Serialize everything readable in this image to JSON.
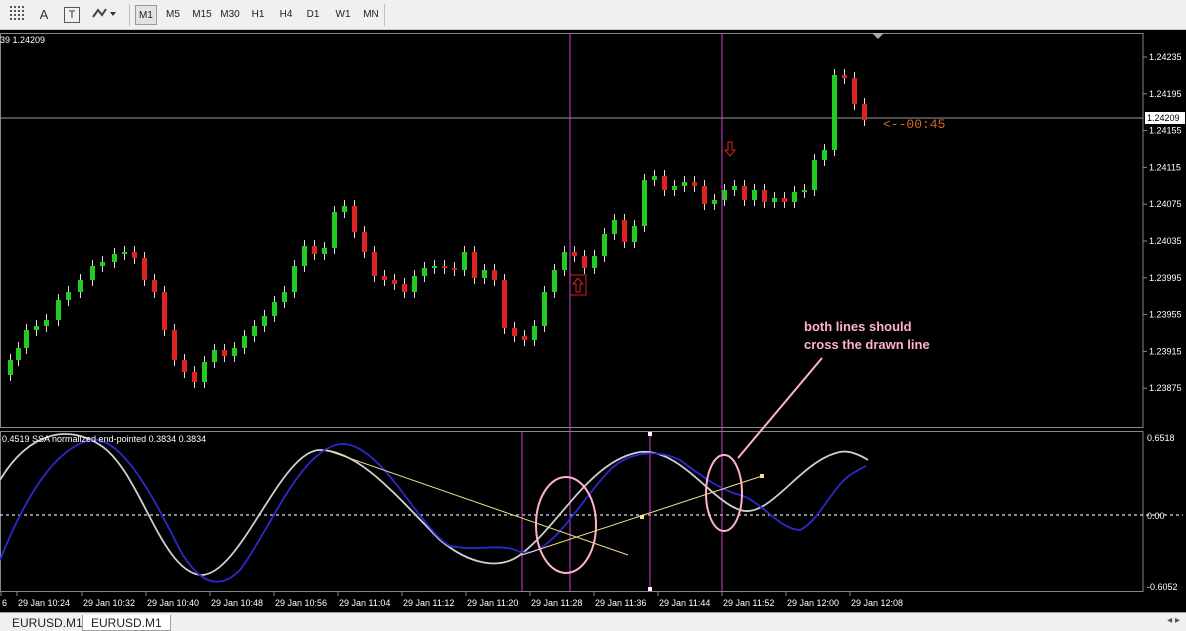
{
  "toolbar": {
    "icons": [
      "crosshair-grid-icon",
      "text-icon",
      "text-label-icon",
      "shapes-icon"
    ],
    "text_icon_glyph": "A",
    "label_icon_glyph": "T",
    "timeframes": [
      "M1",
      "M5",
      "M15",
      "M30",
      "H1",
      "H4",
      "D1",
      "W1",
      "MN"
    ],
    "active_timeframe": "M1"
  },
  "chart": {
    "ohlc_text": "39 1.24209",
    "current_price_label": "1.24209",
    "countdown": "<--00:45",
    "price_axis": [
      "1.24235",
      "1.24195",
      "1.24155",
      "1.24115",
      "1.24075",
      "1.24035",
      "1.23995",
      "1.23955",
      "1.23915",
      "1.23875"
    ],
    "time_axis": [
      "6",
      "29 Jan 10:24",
      "29 Jan 10:32",
      "29 Jan 10:40",
      "29 Jan 10:48",
      "29 Jan 10:56",
      "29 Jan 11:04",
      "29 Jan 11:12",
      "29 Jan 11:20",
      "29 Jan 11:28",
      "29 Jan 11:36",
      "29 Jan 11:44",
      "29 Jan 11:52",
      "29 Jan 12:00",
      "29 Jan 12:08"
    ]
  },
  "indicator": {
    "label": "0.4519  SSA normalized end-pointed 0.3834 0.3834",
    "axis_top": "0.6518",
    "axis_zero": "0.00",
    "axis_bottom": "-0.6052"
  },
  "annotation": {
    "line1": "both lines should",
    "line2": "cross the drawn line"
  },
  "tabs": [
    "EURUSD.M1",
    "EURUSD.M1"
  ],
  "active_tab": 1,
  "colors": {
    "bull": "#22cc22",
    "bear": "#dd2222",
    "vline": "#cc44cc",
    "annot": "#ffb3c8",
    "drawn_line": "#f5e08a",
    "blue_line": "#2a2acc",
    "gray_line": "#cfcfcf"
  }
}
